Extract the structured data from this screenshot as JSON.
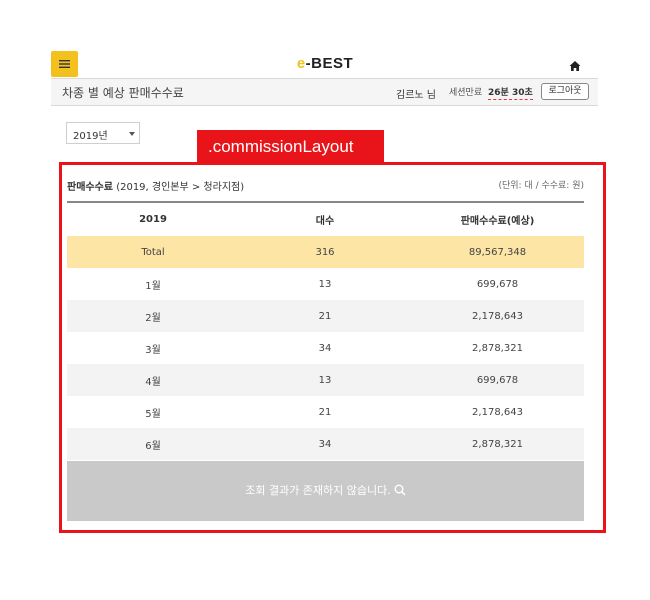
{
  "header": {
    "logo_prefix": "e",
    "logo_suffix": "-BEST"
  },
  "subbar": {
    "title": "차종 별 예상 판매수수료",
    "user": "김르노 님",
    "session_label": "세션만료",
    "session_time": "26분 30초",
    "logout_label": "로그아웃"
  },
  "filter": {
    "year": "2019년"
  },
  "annotation": {
    "label": ".commissionLayout"
  },
  "panel": {
    "title_bold": "판매수수료",
    "title_detail": "(2019, 경인본부 > 청라지점)",
    "unit": "(단위: 대 / 수수료: 원)"
  },
  "table": {
    "headers": [
      "2019",
      "대수",
      "판매수수료(예상)"
    ],
    "total": {
      "label": "Total",
      "count": "316",
      "fee": "89,567,348"
    },
    "rows": [
      {
        "label": "1월",
        "count": "13",
        "fee": "699,678"
      },
      {
        "label": "2월",
        "count": "21",
        "fee": "2,178,643"
      },
      {
        "label": "3월",
        "count": "34",
        "fee": "2,878,321"
      },
      {
        "label": "4월",
        "count": "13",
        "fee": "699,678"
      },
      {
        "label": "5월",
        "count": "21",
        "fee": "2,178,643"
      },
      {
        "label": "6월",
        "count": "34",
        "fee": "2,878,321"
      }
    ],
    "empty_message": "조회 결과가 존재하지 않습니다."
  },
  "colors": {
    "accent": "#f3c11d",
    "annotation": "#e8141a",
    "total_row": "#fde5a6",
    "empty_row": "#c9c9c9"
  },
  "icons": [
    "menu-icon",
    "home-icon",
    "chevron-down-icon",
    "search-icon"
  ]
}
